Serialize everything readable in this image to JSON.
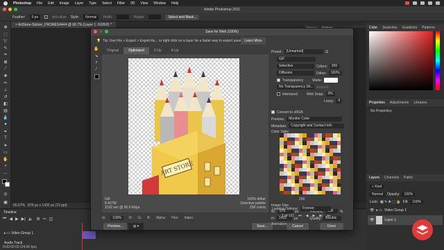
{
  "menubar": {
    "app": "Photoshop",
    "items": [
      "File",
      "Edit",
      "Image",
      "Layer",
      "Type",
      "Select",
      "Filter",
      "3D",
      "View",
      "Window",
      "Help"
    ]
  },
  "app": {
    "window_title": "Adobe Photoshop 2021"
  },
  "options_bar": {
    "feather_label": "Feather:",
    "feather_value": "0 px",
    "antialias_label": "Anti-alias",
    "style_label": "Style:",
    "style_value": "Normal",
    "width_label": "Width:",
    "height_label": "Height:",
    "select_mask_label": "Select and Mask..."
  },
  "document_tab": "ArtStore-Sticker_PRORES4444 @ 66.7% (Layer 1, RGB/8) *",
  "history_tabs": [
    "History",
    "Actions"
  ],
  "status_bar": {
    "zoom": "66.67%",
    "dims": "876 px x 1432 px (72 ppi)"
  },
  "timeline": {
    "title": "Timeline",
    "track1": "Video Group 1",
    "track2": "Audio Track",
    "time": "0:00:00:00",
    "fps": "(24.00 fps)"
  },
  "right_panels": {
    "color_tabs": [
      "Color",
      "Swatches",
      "Gradients",
      "Patterns"
    ],
    "props_tabs": [
      "Properties",
      "Adjustments",
      "Libraries"
    ],
    "props_empty": "No Properties",
    "layers_tabs": [
      "Layers",
      "Channels",
      "Paths"
    ],
    "kind_label": "Kind",
    "blend_mode": "Normal",
    "opacity_label": "Opacity:",
    "opacity_value": "100%",
    "lock_label": "Lock:",
    "fill_label": "Fill:",
    "fill_value": "100%",
    "layer_group": "Video Group 1",
    "layer_1": "Layer 1"
  },
  "dialog": {
    "title": "Save for Web (100%)",
    "tip": "Tip: Use File > Export > Export As... or right click on a layer for a faster way to export assets",
    "learn_more": "Learn More",
    "view_tabs": [
      "Original",
      "Optimized",
      "2-Up",
      "4-Up"
    ],
    "active_view": "Optimized",
    "image_label": "ART STORE",
    "info_left": [
      "GIF",
      "8.427M",
      "1192 sec @ 56.6 Kbps"
    ],
    "info_right": [
      "100% dither",
      "Selective palette",
      "258 colors"
    ],
    "zoom": "100%",
    "r_label": "R:",
    "g_label": "G:",
    "b_label": "B:",
    "alpha_label": "Alpha:",
    "hex_label": "Hex:",
    "index_label": "Index:",
    "preview_button": "Preview...",
    "browser_icon": "globe",
    "save_button": "Save...",
    "cancel_button": "Cancel",
    "done_button": "Done",
    "frame_counter": "1 of 121"
  },
  "settings": {
    "preset_label": "Preset:",
    "preset_value": "[Unnamed]",
    "format": "GIF",
    "reduction": "Selective",
    "colors_label": "Colors:",
    "colors_value": "256",
    "dither_algo": "Diffusion",
    "dither_label": "Dither:",
    "dither_value": "100%",
    "transparency_label": "Transparency",
    "transparency_checked": true,
    "matte_label": "Matte:",
    "trans_dither": "No Transparency Dit...",
    "amount_label": "Amount:",
    "interlaced_label": "Interlaced",
    "websnap_label": "Web Snap:",
    "websnap_value": "0%",
    "lossy_label": "Lossy:",
    "lossy_value": "0",
    "convert_srgb": "Convert to sRGB",
    "preview_label": "Preview:",
    "preview_value": "Monitor Color",
    "metadata_label": "Metadata:",
    "metadata_value": "Copyright and Contact Info",
    "color_table_title": "Color Table",
    "color_count": "256",
    "image_size_title": "Image Size",
    "w_label": "W:",
    "w_value": "876",
    "h_label": "H:",
    "h_value": "1432",
    "px_unit": "px",
    "percent_label": "Percent:",
    "percent_value": "100",
    "pct_unit": "%",
    "quality_label": "Quality:",
    "quality_value": "Bicubic",
    "animation_title": "Animation",
    "looping_label": "Looping Options:",
    "looping_value": "Forever"
  },
  "colors": {
    "accent_red": "#e03a3a",
    "clip_purple": "#6f57b8",
    "ps_dark": "#2b2b2b"
  }
}
